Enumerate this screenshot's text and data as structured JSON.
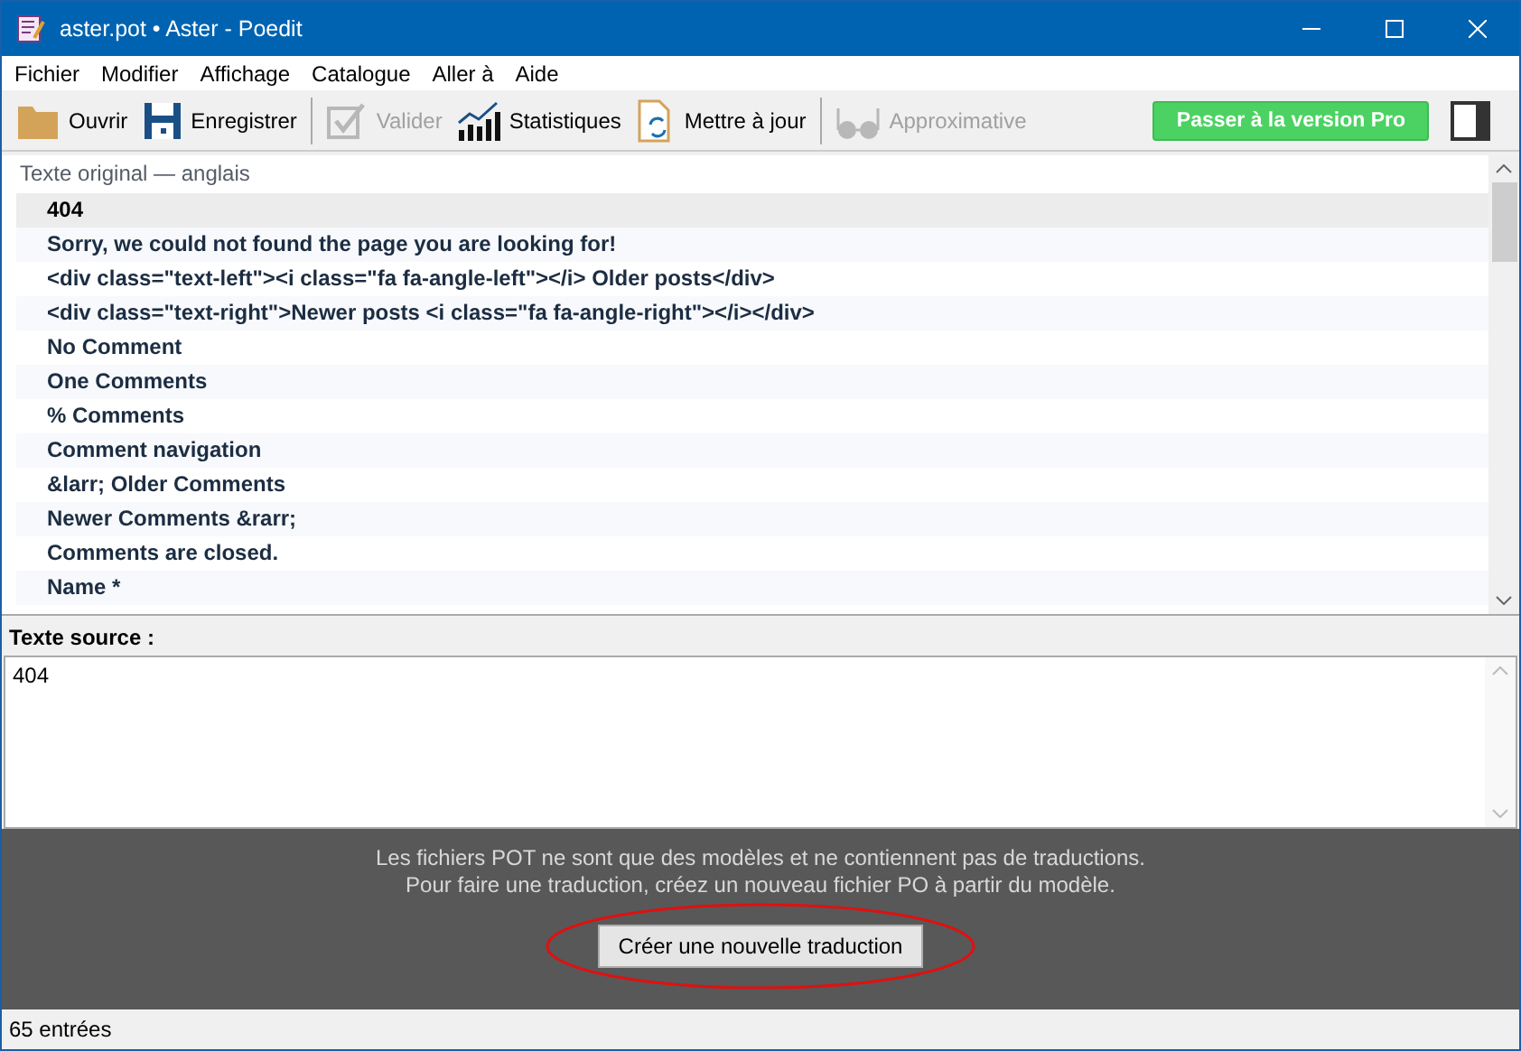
{
  "window": {
    "title": "aster.pot • Aster - Poedit"
  },
  "menu": [
    "Fichier",
    "Modifier",
    "Affichage",
    "Catalogue",
    "Aller à",
    "Aide"
  ],
  "toolbar": [
    {
      "kind": "open",
      "label": "Ouvrir",
      "disabled": false
    },
    {
      "kind": "save",
      "label": "Enregistrer",
      "disabled": false
    },
    {
      "kind": "validate",
      "label": "Valider",
      "disabled": true
    },
    {
      "kind": "stats",
      "label": "Statistiques",
      "disabled": false
    },
    {
      "kind": "update",
      "label": "Mettre à jour",
      "disabled": false
    },
    {
      "kind": "fuzzy",
      "label": "Approximative",
      "disabled": true
    }
  ],
  "pro_button": "Passer à la version Pro",
  "list": {
    "header": "Texte original — anglais",
    "rows": [
      {
        "text": "404",
        "selected": true
      },
      {
        "text": "Sorry, we could not found the page you are looking for!",
        "selected": false
      },
      {
        "text": "<div class=\"text-left\"><i class=\"fa fa-angle-left\"></i> Older posts</div>",
        "selected": false
      },
      {
        "text": "<div class=\"text-right\">Newer posts <i class=\"fa fa-angle-right\"></i></div>",
        "selected": false
      },
      {
        "text": "No Comment",
        "selected": false
      },
      {
        "text": "One Comments",
        "selected": false
      },
      {
        "text": "% Comments",
        "selected": false
      },
      {
        "text": "Comment navigation",
        "selected": false
      },
      {
        "text": "&larr; Older Comments",
        "selected": false
      },
      {
        "text": "Newer Comments &rarr;",
        "selected": false
      },
      {
        "text": "Comments are closed.",
        "selected": false
      },
      {
        "text": "Name *",
        "selected": false
      }
    ]
  },
  "source": {
    "label": "Texte source :",
    "value": "404"
  },
  "notice": {
    "lines": [
      "Les fichiers POT ne sont que des modèles et ne contiennent pas de traductions.",
      "Pour faire une traduction, créez un nouveau fichier PO à partir du modèle."
    ],
    "button": "Créer une nouvelle traduction"
  },
  "status_bar": "65 entrées"
}
